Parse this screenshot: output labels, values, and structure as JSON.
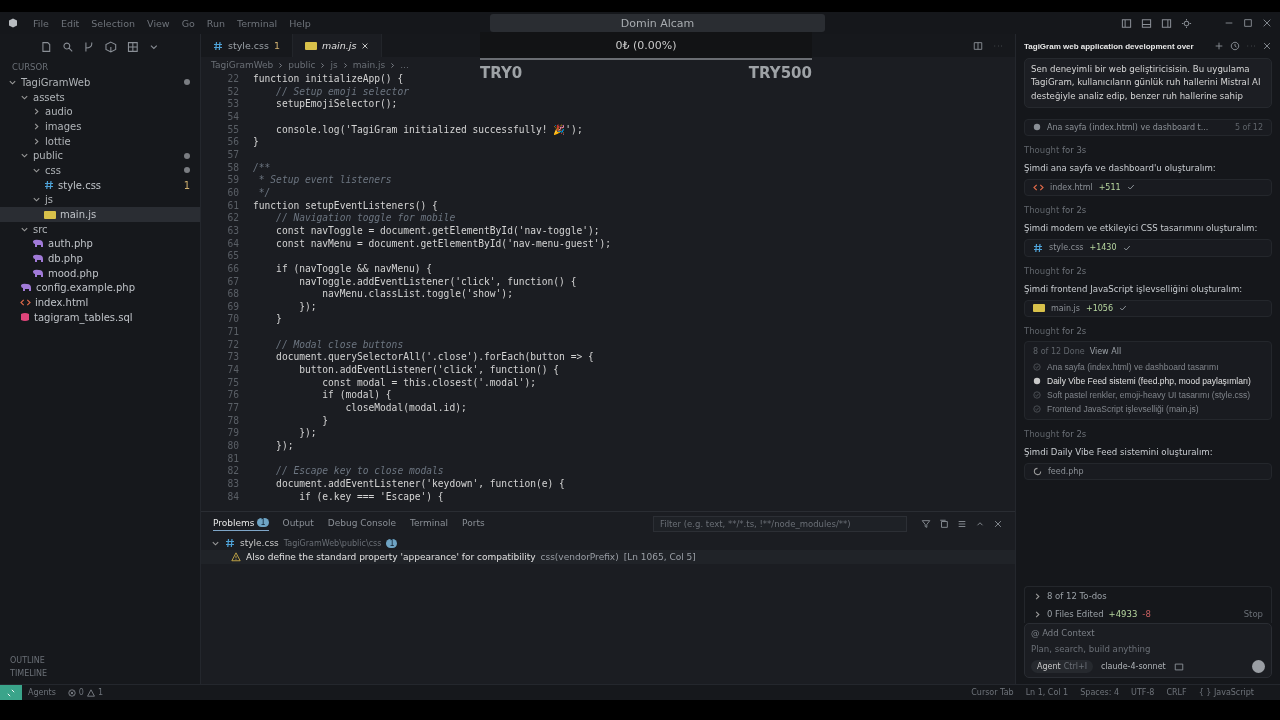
{
  "menu": [
    "File",
    "Edit",
    "Selection",
    "View",
    "Go",
    "Run",
    "Terminal",
    "Help"
  ],
  "overlay": {
    "title": "Domin Alcam",
    "value": "0₺ (0.00%)",
    "min_label": "TRY0",
    "max_label": "TRY500"
  },
  "sidebar": {
    "header": "CURSOR",
    "tree": [
      {
        "name": "TagiGramWeb",
        "kind": "folder",
        "expanded": true,
        "selected": false,
        "modified": true,
        "children": [
          {
            "name": "assets",
            "kind": "folder",
            "expanded": true,
            "selected": false,
            "modified": false,
            "children": [
              {
                "name": "audio",
                "kind": "folder",
                "expanded": false,
                "selected": false,
                "modified": false
              },
              {
                "name": "images",
                "kind": "folder",
                "expanded": false,
                "selected": false,
                "modified": false
              },
              {
                "name": "lottie",
                "kind": "folder",
                "expanded": false,
                "selected": false,
                "modified": false
              }
            ]
          },
          {
            "name": "public",
            "kind": "folder",
            "expanded": true,
            "selected": false,
            "modified": true,
            "children": [
              {
                "name": "css",
                "kind": "folder",
                "expanded": true,
                "selected": false,
                "modified": true,
                "children": [
                  {
                    "name": "style.css",
                    "kind": "css",
                    "selected": false,
                    "modified": false,
                    "badge": "1"
                  }
                ]
              },
              {
                "name": "js",
                "kind": "folder",
                "expanded": true,
                "selected": false,
                "modified": false,
                "children": [
                  {
                    "name": "main.js",
                    "kind": "js",
                    "selected": true,
                    "modified": false
                  }
                ]
              }
            ]
          },
          {
            "name": "src",
            "kind": "folder",
            "expanded": true,
            "selected": false,
            "modified": false,
            "children": [
              {
                "name": "auth.php",
                "kind": "php",
                "selected": false,
                "modified": false
              },
              {
                "name": "db.php",
                "kind": "php",
                "selected": false,
                "modified": false
              },
              {
                "name": "mood.php",
                "kind": "php",
                "selected": false,
                "modified": false
              }
            ]
          },
          {
            "name": "config.example.php",
            "kind": "php",
            "selected": false,
            "modified": false
          },
          {
            "name": "index.html",
            "kind": "html",
            "selected": false,
            "modified": false
          },
          {
            "name": "tagigram_tables.sql",
            "kind": "sql",
            "selected": false,
            "modified": false
          }
        ]
      }
    ],
    "footer": [
      "OUTLINE",
      "TIMELINE"
    ]
  },
  "editor": {
    "tabs": [
      {
        "label": "style.css",
        "kind": "css",
        "badge": "1",
        "selected": false
      },
      {
        "label": "main.js",
        "kind": "js",
        "selected": true
      }
    ],
    "breadcrumb": [
      "TagiGramWeb",
      "public",
      "js",
      "main.js",
      "..."
    ],
    "lines": [
      {
        "num": "22",
        "kind": "code",
        "text": "function initializeApp() {"
      },
      {
        "num": "52",
        "kind": "comment",
        "text": "    // Setup emoji selector"
      },
      {
        "num": "53",
        "kind": "code",
        "text": "    setupEmojiSelector();"
      },
      {
        "num": "54"
      },
      {
        "num": "55",
        "kind": "code",
        "text": "    console.log('TagiGram initialized successfully! 🎉');"
      },
      {
        "num": "56",
        "kind": "code",
        "text": "}"
      },
      {
        "num": "57"
      },
      {
        "num": "58",
        "kind": "comment",
        "text": "/**"
      },
      {
        "num": "59",
        "kind": "comment",
        "text": " * Setup event listeners"
      },
      {
        "num": "60",
        "kind": "comment",
        "text": " */"
      },
      {
        "num": "61",
        "kind": "code",
        "text": "function setupEventListeners() {"
      },
      {
        "num": "62",
        "kind": "comment",
        "text": "    // Navigation toggle for mobile"
      },
      {
        "num": "63",
        "kind": "code",
        "text": "    const navToggle = document.getElementById('nav-toggle');"
      },
      {
        "num": "64",
        "kind": "code",
        "text": "    const navMenu = document.getElementById('nav-menu-guest');"
      },
      {
        "num": "65"
      },
      {
        "num": "66",
        "kind": "code",
        "text": "    if (navToggle && navMenu) {"
      },
      {
        "num": "67",
        "kind": "code",
        "text": "        navToggle.addEventListener('click', function() {"
      },
      {
        "num": "68",
        "kind": "code",
        "text": "            navMenu.classList.toggle('show');"
      },
      {
        "num": "69",
        "kind": "code",
        "text": "        });"
      },
      {
        "num": "70",
        "kind": "code",
        "text": "    }"
      },
      {
        "num": "71"
      },
      {
        "num": "72",
        "kind": "comment",
        "text": "    // Modal close buttons"
      },
      {
        "num": "73",
        "kind": "code",
        "text": "    document.querySelectorAll('.close').forEach(button => {"
      },
      {
        "num": "74",
        "kind": "code",
        "text": "        button.addEventListener('click', function() {"
      },
      {
        "num": "75",
        "kind": "code",
        "text": "            const modal = this.closest('.modal');"
      },
      {
        "num": "76",
        "kind": "code",
        "text": "            if (modal) {"
      },
      {
        "num": "77",
        "kind": "code",
        "text": "                closeModal(modal.id);"
      },
      {
        "num": "78",
        "kind": "code",
        "text": "            }"
      },
      {
        "num": "79",
        "kind": "code",
        "text": "        });"
      },
      {
        "num": "80",
        "kind": "code",
        "text": "    });"
      },
      {
        "num": "81"
      },
      {
        "num": "82",
        "kind": "comment",
        "text": "    // Escape key to close modals"
      },
      {
        "num": "83",
        "kind": "code",
        "text": "    document.addEventListener('keydown', function(e) {"
      },
      {
        "num": "84",
        "kind": "code",
        "text": "        if (e.key === 'Escape') {"
      }
    ]
  },
  "panel": {
    "tabs": [
      {
        "label": "Problems",
        "badge": "1",
        "selected": true
      },
      {
        "label": "Output",
        "selected": false
      },
      {
        "label": "Debug Console",
        "selected": false
      },
      {
        "label": "Terminal",
        "selected": false
      },
      {
        "label": "Ports",
        "selected": false
      }
    ],
    "filter": {
      "placeholder": "Filter (e.g. text, **/*.ts, !**/node_modules/**)"
    },
    "group": {
      "file": "style.css",
      "path": "TagiGramWeb\\public\\css",
      "count": "1",
      "expanded": true
    },
    "problems": [
      {
        "kind": "warning",
        "message": "Also define the standard property 'appearance' for compatibility",
        "source": "css(vendorPrefix)",
        "location": "[Ln 1065, Col 5]"
      }
    ]
  },
  "chat": {
    "title": "TagiGram web application development over",
    "prompt": "Sen deneyimli bir web geliştiricisisin. Bu uygulama TagiGram, kullanıcıların günlük ruh hallerini Mistral AI desteğiyle analiz edip, benzer ruh hallerine sahip",
    "messages": [
      {
        "kind": "todo",
        "text": "Ana sayfa (index.html) ve dashboard t...",
        "count": "5 of 12"
      },
      {
        "kind": "thought",
        "label": "Thought",
        "duration": "for 3s"
      },
      {
        "kind": "text",
        "text": "Şimdi ana sayfa ve dashboard'u oluşturalım:"
      },
      {
        "kind": "file",
        "file": {
          "kind": "html",
          "name": "index.html",
          "added": "+511",
          "done": true
        }
      },
      {
        "kind": "thought",
        "label": "Thought",
        "duration": "for 2s"
      },
      {
        "kind": "text",
        "text": "Şimdi modern ve etkileyici CSS tasarımını oluşturalım:"
      },
      {
        "kind": "file",
        "file": {
          "kind": "css",
          "name": "style.css",
          "added": "+1430",
          "done": true
        }
      },
      {
        "kind": "thought",
        "label": "Thought",
        "duration": "for 2s"
      },
      {
        "kind": "text",
        "text": "Şimdi frontend JavaScript işlevselliğini oluşturalım:"
      },
      {
        "kind": "file",
        "file": {
          "kind": "js",
          "name": "main.js",
          "added": "+1056",
          "done": true
        }
      },
      {
        "kind": "thought",
        "label": "Thought",
        "duration": "for 2s"
      },
      {
        "kind": "todos",
        "summary": "8 of 12 Done",
        "link": "View All",
        "items": [
          {
            "text": "Ana sayfa (index.html) ve dashboard tasarımı",
            "done": true
          },
          {
            "text": "Daily Vibe Feed sistemi (feed.php, mood paylaşımları)",
            "done": false
          },
          {
            "text": "Soft pastel renkler, emoji-heavy UI tasarımı (style.css)",
            "done": true
          },
          {
            "text": "Frontend JavaScript işlevselliği (main.js)",
            "done": true
          }
        ]
      },
      {
        "kind": "thought",
        "label": "Thought",
        "duration": "for 2s"
      },
      {
        "kind": "text",
        "text": "Şimdi Daily Vibe Feed sistemini oluşturalım:"
      },
      {
        "kind": "file",
        "file": {
          "kind": "loading",
          "name": "feed.php",
          "done": false
        }
      }
    ],
    "todos_summary": "8 of 12 To-dos",
    "edits": {
      "label": "0 Files Edited",
      "added": "+4933",
      "removed": "-8",
      "stop": "Stop"
    },
    "composer": {
      "context": "@ Add Context",
      "placeholder": "Plan, search, build anything",
      "mode": "Agent",
      "shortcut": "Ctrl+I",
      "model": "claude-4-sonnet"
    }
  },
  "status": {
    "left": {
      "agents": "Agents",
      "errors": "0",
      "warnings": "1"
    },
    "right": [
      "Cursor Tab",
      "Ln 1, Col 1",
      "Spaces: 4",
      "UTF-8",
      "CRLF",
      "{ } JavaScript"
    ]
  }
}
